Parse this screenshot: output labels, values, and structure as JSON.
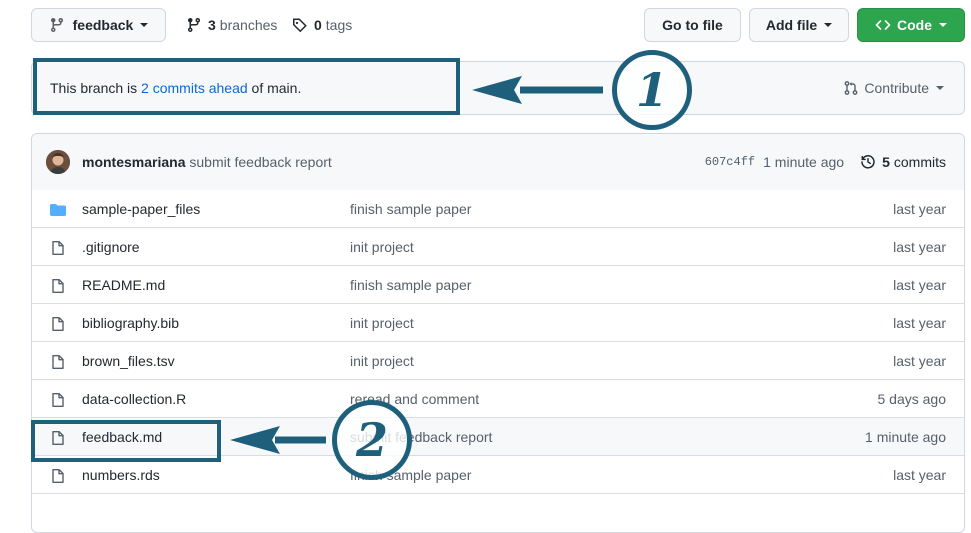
{
  "toolbar": {
    "branch_button": "feedback",
    "branches_count": "3",
    "branches_label": "branches",
    "tags_count": "0",
    "tags_label": "tags",
    "go_to_file": "Go to file",
    "add_file": "Add file",
    "code": "Code"
  },
  "banner": {
    "prefix": "This branch is ",
    "link": "2 commits ahead",
    "suffix": " of main.",
    "contribute": "Contribute"
  },
  "latest_commit": {
    "author": "montesmariana",
    "message": "submit feedback report",
    "sha": "607c4ff",
    "time": "1 minute ago",
    "commits_count": "5",
    "commits_label": "commits"
  },
  "files": [
    {
      "name": "sample-paper_files",
      "type": "folder",
      "message": "finish sample paper",
      "time": "last year"
    },
    {
      "name": ".gitignore",
      "type": "file",
      "message": "init project",
      "time": "last year"
    },
    {
      "name": "README.md",
      "type": "file",
      "message": "finish sample paper",
      "time": "last year"
    },
    {
      "name": "bibliography.bib",
      "type": "file",
      "message": "init project",
      "time": "last year"
    },
    {
      "name": "brown_files.tsv",
      "type": "file",
      "message": "init project",
      "time": "last year"
    },
    {
      "name": "data-collection.R",
      "type": "file",
      "message": "reread and comment",
      "time": "5 days ago"
    },
    {
      "name": "feedback.md",
      "type": "file",
      "message": "submit feedback report",
      "time": "1 minute ago"
    },
    {
      "name": "numbers.rds",
      "type": "file",
      "message": "finish sample paper",
      "time": "last year"
    }
  ],
  "annotations": [
    {
      "label": "1"
    },
    {
      "label": "2"
    }
  ],
  "colors": {
    "annotation": "#1e5f7c",
    "link": "#0969da",
    "folder": "#54aeff",
    "code_button": "#2da44e"
  }
}
